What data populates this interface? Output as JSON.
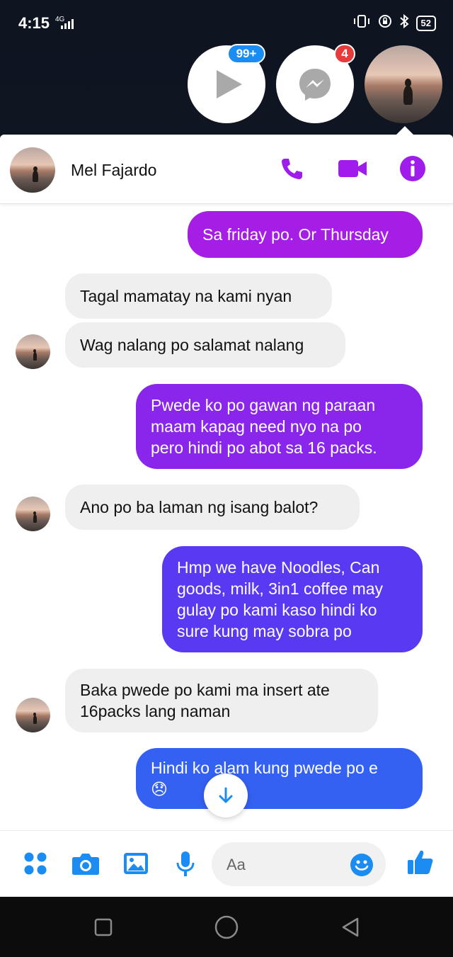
{
  "status_bar": {
    "time": "4:15",
    "network": "4G",
    "battery": "52"
  },
  "chat_heads": {
    "video_badge": "99+",
    "messenger_badge": "4"
  },
  "conversation": {
    "contact_name": "Mel Fajardo",
    "messages": [
      {
        "direction": "out",
        "text": "Sa friday po. Or Thursday",
        "color": "#a61ee6"
      },
      {
        "direction": "in",
        "text": "Tagal mamatay na kami nyan"
      },
      {
        "direction": "in",
        "text": "Wag nalang po salamat nalang"
      },
      {
        "direction": "out",
        "lines": [
          "Pwede ko po gawan ng paraan",
          "maam kapag need nyo na po",
          "pero hindi po abot sa 16 packs."
        ],
        "color": "#8a26ec"
      },
      {
        "direction": "in",
        "text": "Ano po ba laman ng isang balot?"
      },
      {
        "direction": "out",
        "lines": [
          "Hmp we have Noodles, Can",
          "goods, milk, 3in1 coffee may",
          "gulay po kami kaso hindi ko",
          "sure kung may sobra po"
        ],
        "color": "#5a39f3"
      },
      {
        "direction": "in",
        "lines": [
          "Baka pwede po kami ma insert ate",
          "16packs lang naman"
        ]
      },
      {
        "direction": "out",
        "lines": [
          "Hindi ko alam kung pwede po e",
          "😞"
        ],
        "color": "#3561f2"
      }
    ]
  },
  "composer": {
    "placeholder": "Aa"
  },
  "colors": {
    "accent_purple": "#a01cec",
    "composer_blue": "#1a8cf2"
  }
}
